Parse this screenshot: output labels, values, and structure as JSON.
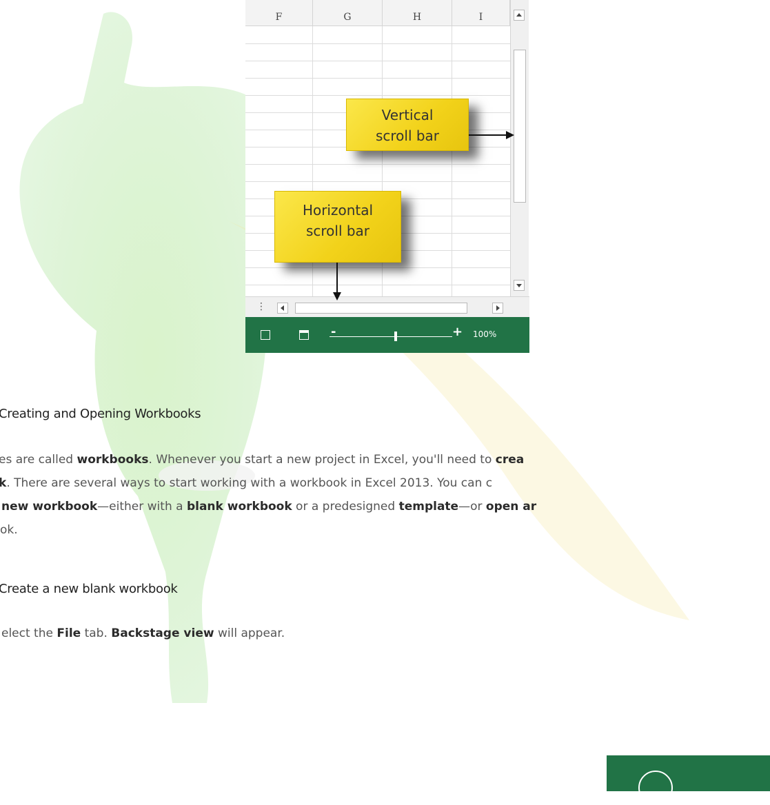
{
  "spreadsheet": {
    "column_headers": [
      "F",
      "G",
      "H",
      "I"
    ],
    "zoom_level": "100%",
    "callouts": {
      "vertical": [
        "Vertical",
        "scroll bar"
      ],
      "horizontal": [
        "Horizontal",
        "scroll bar"
      ]
    }
  },
  "article": {
    "section_heading": "Creating and Opening Workbooks",
    "paragraph": {
      "line1": {
        "t1": "es are called ",
        "b1": "workbooks",
        "t2": ". Whenever you start a new project in Excel, you'll need to ",
        "b2": "crea"
      },
      "line2": {
        "b1": "k",
        "t1": ". There are several ways to start working with a workbook in Excel 2013. You can c"
      },
      "line3": {
        "b1": "new workbook",
        "t1": "—either with a ",
        "b2": "blank workbook",
        "t2": " or a predesigned ",
        "b3": "template",
        "t3": "—or ",
        "b4": "open ar"
      },
      "line4": "ok."
    },
    "subheading": "Create a new blank workbook",
    "step": {
      "t1": "elect the ",
      "b1": "File",
      "t2": " tab. ",
      "b2": "Backstage view",
      "t3": " will appear."
    }
  },
  "colors": {
    "excel_green": "#217346",
    "callout_yellow": "#f5d820"
  }
}
